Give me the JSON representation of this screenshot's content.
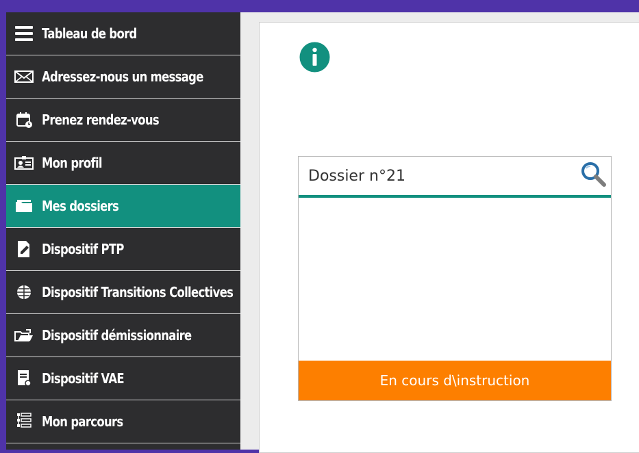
{
  "sidebar": {
    "items": [
      {
        "label": "Tableau de bord",
        "icon": "menu-icon",
        "active": false
      },
      {
        "label": "Adressez-nous un message",
        "icon": "envelope-icon",
        "active": false
      },
      {
        "label": "Prenez rendez-vous",
        "icon": "calendar-icon",
        "active": false
      },
      {
        "label": "Mon profil",
        "icon": "id-card-icon",
        "active": false
      },
      {
        "label": "Mes dossiers",
        "icon": "folder-icon",
        "active": true
      },
      {
        "label": "Dispositif PTP",
        "icon": "document-edit-icon",
        "active": false
      },
      {
        "label": "Dispositif Transitions Collectives",
        "icon": "group-icon",
        "active": false
      },
      {
        "label": "Dispositif démissionnaire",
        "icon": "folder-exit-icon",
        "active": false
      },
      {
        "label": "Dispositif VAE",
        "icon": "certificate-icon",
        "active": false
      },
      {
        "label": "Mon parcours",
        "icon": "steps-icon",
        "active": false
      }
    ]
  },
  "main": {
    "info_icon": "info-icon",
    "card": {
      "title": "Dossier n°21",
      "search_icon": "search-icon",
      "status": "En cours d\\instruction"
    }
  },
  "colors": {
    "background": "#4f33a8",
    "sidebar": "#2d2d2f",
    "accent": "#12907f",
    "status": "#fd7f00"
  }
}
